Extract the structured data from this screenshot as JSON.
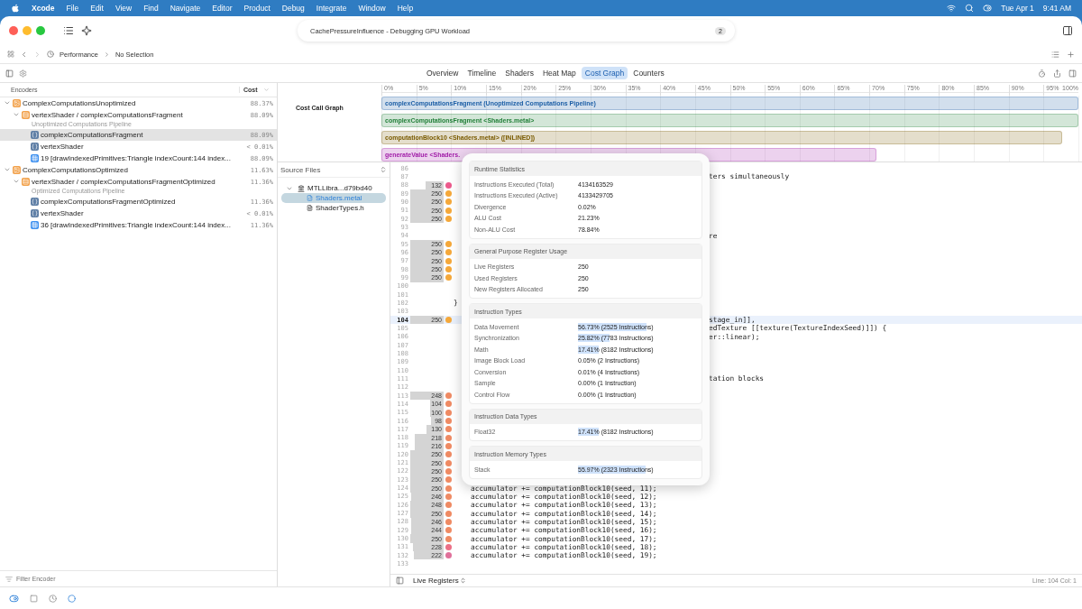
{
  "menu_bar": {
    "app": "Xcode",
    "items": [
      "File",
      "Edit",
      "View",
      "Find",
      "Navigate",
      "Editor",
      "Product",
      "Debug",
      "Integrate",
      "Window",
      "Help"
    ],
    "date": "Tue Apr 1",
    "time": "9:41 AM"
  },
  "window": {
    "title": "CachePressureInfluence - Debugging GPU Workload",
    "badge": "2"
  },
  "breadcrumb": [
    "Performance",
    "No Selection"
  ],
  "tabs": [
    {
      "label": "Overview",
      "selected": false
    },
    {
      "label": "Timeline",
      "selected": false
    },
    {
      "label": "Shaders",
      "selected": false
    },
    {
      "label": "Heat Map",
      "selected": false
    },
    {
      "label": "Cost Graph",
      "selected": true
    },
    {
      "label": "Counters",
      "selected": false
    }
  ],
  "encoders": {
    "header": "Encoders",
    "cost_header": "Cost",
    "filter_placeholder": "Filter Encoder",
    "items": [
      {
        "label": "ComplexComputationsUnoptimized",
        "cost": "88.37%",
        "kind": "encoder",
        "expanded": true,
        "selected": false,
        "children": [
          {
            "label": "vertexShader / complexComputationsFragment",
            "subtitle": "Unoptimized Computations Pipeline",
            "cost": "88.09%",
            "kind": "pipeline",
            "expanded": true,
            "selected": false,
            "children": [
              {
                "label": "complexComputationsFragment",
                "cost": "88.09%",
                "kind": "function",
                "selected": true
              },
              {
                "label": "vertexShader",
                "cost": "< 0.01%",
                "kind": "function",
                "selected": false
              },
              {
                "label": "19 [drawIndexedPrimitives:Triangle indexCount:144 index...",
                "cost": "88.09%",
                "kind": "draw",
                "selected": false
              }
            ]
          }
        ]
      },
      {
        "label": "ComplexComputationsOptimized",
        "cost": "11.63%",
        "kind": "encoder",
        "expanded": true,
        "selected": false,
        "children": [
          {
            "label": "vertexShader / complexComputationsFragmentOptimized",
            "subtitle": "Optimized Computations Pipeline",
            "cost": "11.36%",
            "kind": "pipeline",
            "expanded": true,
            "selected": false,
            "children": [
              {
                "label": "complexComputationsFragmentOptimized",
                "cost": "11.36%",
                "kind": "function",
                "selected": false
              },
              {
                "label": "vertexShader",
                "cost": "< 0.01%",
                "kind": "function",
                "selected": false
              },
              {
                "label": "36 [drawIndexedPrimitives:Triangle indexCount:144 index...",
                "cost": "11.36%",
                "kind": "draw",
                "selected": false
              }
            ]
          }
        ]
      }
    ]
  },
  "cost_graph": {
    "title": "Cost Call Graph",
    "ticks": [
      "0%",
      "5%",
      "10%",
      "15%",
      "20%",
      "25%",
      "30%",
      "35%",
      "40%",
      "45%",
      "50%",
      "55%",
      "60%",
      "65%",
      "70%",
      "75%",
      "80%",
      "85%",
      "90%",
      "95%",
      "100%"
    ],
    "bars": [
      {
        "label": "complexComputationsFragment (Unoptimized Computations Pipeline)",
        "color": "#1d5fa6",
        "level": 1
      },
      {
        "label": "complexComputationsFragment <Shaders.metal>",
        "color": "#23803a",
        "level": 1
      },
      {
        "label": "computationBlock10 <Shaders.metal> ([INLINED])",
        "color": "#7a5b00",
        "level": 0.977
      },
      {
        "label": "generateValue <Shaders.",
        "color": "#a11ca8",
        "level": 0.71
      }
    ]
  },
  "source_files": {
    "header": "Source Files",
    "items": [
      {
        "label": "MTLLibra...d79bd40",
        "kind": "library",
        "expanded": true,
        "selected": false,
        "children": [
          {
            "label": "Shaders.metal",
            "kind": "metal",
            "selected": true
          },
          {
            "label": "ShaderTypes.h",
            "kind": "header",
            "selected": false
          }
        ]
      }
    ]
  },
  "editor": {
    "status_left": "Live Registers",
    "position": "Line: 104 Col: 1",
    "lines": [
      {
        "number": "86",
        "selected": false
      },
      {
        "number": "87",
        "selected": false,
        "code": {
          "kind": "clipped",
          "text": "ters simultaneously"
        }
      },
      {
        "number": "88",
        "selected": false,
        "registers": "132",
        "color": "#ec5a8c"
      },
      {
        "number": "89",
        "selected": false,
        "registers": "250",
        "color": "#f5a83a"
      },
      {
        "number": "90",
        "selected": false,
        "registers": "250",
        "color": "#f5a83a"
      },
      {
        "number": "91",
        "selected": false,
        "registers": "250",
        "color": "#f5a83a"
      },
      {
        "number": "92",
        "selected": false,
        "registers": "250",
        "color": "#f5a83a"
      },
      {
        "number": "93",
        "selected": false
      },
      {
        "number": "94",
        "selected": false,
        "code": {
          "kind": "clipped",
          "text": "re"
        }
      },
      {
        "number": "95",
        "selected": false,
        "registers": "250",
        "color": "#f5a83a"
      },
      {
        "number": "96",
        "selected": false,
        "registers": "250",
        "color": "#f5a83a"
      },
      {
        "number": "97",
        "selected": false,
        "registers": "250",
        "color": "#f5a83a"
      },
      {
        "number": "98",
        "selected": false,
        "registers": "250",
        "color": "#f5a83a"
      },
      {
        "number": "99",
        "selected": false,
        "registers": "250",
        "color": "#f5a83a"
      },
      {
        "number": "100",
        "selected": false
      },
      {
        "number": "101",
        "selected": false
      },
      {
        "number": "102",
        "selected": false,
        "code": {
          "kind": "top",
          "text": "}"
        }
      },
      {
        "number": "103",
        "selected": false
      },
      {
        "number": "104",
        "selected": true,
        "registers": "250",
        "color": "#f5a83a",
        "code": {
          "kind": "clipped",
          "text": "stage_in]],"
        }
      },
      {
        "number": "105",
        "selected": false,
        "code": {
          "kind": "clipped",
          "text": "edTexture [[texture(TextureIndexSeed)]]) {"
        }
      },
      {
        "number": "106",
        "selected": false,
        "code": {
          "kind": "clipped",
          "text": "er::linear);"
        }
      },
      {
        "number": "107",
        "selected": false
      },
      {
        "number": "108",
        "selected": false
      },
      {
        "number": "109",
        "selected": false
      },
      {
        "number": "110",
        "selected": false
      },
      {
        "number": "111",
        "selected": false,
        "code": {
          "kind": "clipped",
          "text": "tation blocks"
        }
      },
      {
        "number": "112",
        "selected": false
      },
      {
        "number": "113",
        "selected": false,
        "registers": "248",
        "color": "#ef8a63"
      },
      {
        "number": "114",
        "selected": false,
        "registers": "104",
        "color": "#ef8a63"
      },
      {
        "number": "115",
        "selected": false,
        "registers": "100",
        "color": "#ef8a63"
      },
      {
        "number": "116",
        "selected": false,
        "registers": "98",
        "color": "#ef8a63"
      },
      {
        "number": "117",
        "selected": false,
        "registers": "130",
        "color": "#ef8a63"
      },
      {
        "number": "118",
        "selected": false,
        "registers": "218",
        "color": "#ef8a63"
      },
      {
        "number": "119",
        "selected": false,
        "registers": "216",
        "color": "#ef8a63"
      },
      {
        "number": "120",
        "selected": false,
        "registers": "250",
        "color": "#ef8a63"
      },
      {
        "number": "121",
        "selected": false,
        "registers": "250",
        "color": "#ef8a63"
      },
      {
        "number": "122",
        "selected": false,
        "registers": "250",
        "color": "#ef8a63"
      },
      {
        "number": "123",
        "selected": false,
        "registers": "250",
        "color": "#ef8a63"
      },
      {
        "number": "124",
        "selected": false,
        "registers": "250",
        "color": "#ef8a63",
        "code": {
          "kind": "block",
          "text": "accumulator += computationBlock10(seed, 11);"
        }
      },
      {
        "number": "125",
        "selected": false,
        "registers": "246",
        "color": "#ef8a63",
        "code": {
          "kind": "block",
          "text": "accumulator += computationBlock10(seed, 12);"
        }
      },
      {
        "number": "126",
        "selected": false,
        "registers": "248",
        "color": "#ef8a63",
        "code": {
          "kind": "block",
          "text": "accumulator += computationBlock10(seed, 13);"
        }
      },
      {
        "number": "127",
        "selected": false,
        "registers": "250",
        "color": "#ef8a63",
        "code": {
          "kind": "block",
          "text": "accumulator += computationBlock10(seed, 14);"
        }
      },
      {
        "number": "128",
        "selected": false,
        "registers": "246",
        "color": "#ef8a63",
        "code": {
          "kind": "block",
          "text": "accumulator += computationBlock10(seed, 15);"
        }
      },
      {
        "number": "129",
        "selected": false,
        "registers": "244",
        "color": "#ef8a63",
        "code": {
          "kind": "block",
          "text": "accumulator += computationBlock10(seed, 16);"
        }
      },
      {
        "number": "130",
        "selected": false,
        "registers": "250",
        "color": "#ef8a63",
        "code": {
          "kind": "block",
          "text": "accumulator += computationBlock10(seed, 17);"
        }
      },
      {
        "number": "131",
        "selected": false,
        "registers": "228",
        "color": "#ec6f86",
        "code": {
          "kind": "block",
          "text": "accumulator += computationBlock10(seed, 18);"
        }
      },
      {
        "number": "132",
        "selected": false,
        "registers": "222",
        "color": "#e0709a",
        "code": {
          "kind": "block",
          "text": "accumulator += computationBlock10(seed, 19);"
        }
      },
      {
        "number": "133",
        "selected": false
      }
    ]
  },
  "popup": {
    "sections": [
      {
        "title": "Runtime Statistics",
        "rows": [
          {
            "label": "Instructions Executed (Total)",
            "value": "4134163529"
          },
          {
            "label": "Instructions Executed (Active)",
            "value": "4133429705"
          },
          {
            "label": "Divergence",
            "value": "0.02%"
          },
          {
            "label": "ALU Cost",
            "value": "21.23%"
          },
          {
            "label": "Non-ALU Cost",
            "value": "78.84%"
          }
        ]
      },
      {
        "title": "General Purpose Register Usage",
        "rows": [
          {
            "label": "Live Registers",
            "value": "250"
          },
          {
            "label": "Used Registers",
            "value": "250"
          },
          {
            "label": "New Registers Allocated",
            "value": "250"
          }
        ]
      },
      {
        "title": "Instruction Types",
        "rows": [
          {
            "label": "Data Movement",
            "value": "56.73% (2525 Instructions)",
            "highlight": true
          },
          {
            "label": "Synchronization",
            "value": "25.82% (7783 Instructions)",
            "highlight": true
          },
          {
            "label": "Math",
            "value": "17.41% (8182 Instructions)",
            "highlight": true
          },
          {
            "label": "Image Block Load",
            "value": "0.05% (2 Instructions)"
          },
          {
            "label": "Conversion",
            "value": "0.01% (4 Instructions)"
          },
          {
            "label": "Sample",
            "value": "0.00% (1 Instruction)"
          },
          {
            "label": "Control Flow",
            "value": "0.00% (1 Instruction)"
          }
        ]
      },
      {
        "title": "Instruction Data Types",
        "rows": [
          {
            "label": "Float32",
            "value": "17.41% (8182 Instructions)",
            "highlight": true
          }
        ]
      },
      {
        "title": "Instruction Memory Types",
        "rows": [
          {
            "label": "Stack",
            "value": "55.97% (2323 Instructions)",
            "highlight": true
          }
        ]
      }
    ]
  }
}
